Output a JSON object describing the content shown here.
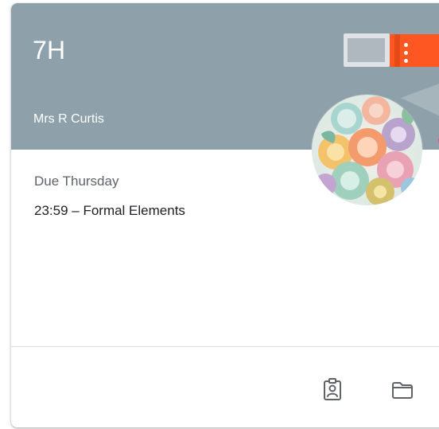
{
  "card": {
    "class_name": "7H",
    "teacher": "Mrs R Curtis",
    "menu_icon": "more-vert-icon"
  },
  "assignment": {
    "due_label": "Due Thursday",
    "title": "23:59 – Formal Elements"
  },
  "footer": {
    "actions": [
      {
        "name": "open-your-work",
        "icon": "assignment-ind-icon"
      },
      {
        "name": "open-class-folder",
        "icon": "folder-icon"
      }
    ]
  },
  "colors": {
    "header": "#8ea1aa",
    "accent_orange": "#f25a2b",
    "text_primary": "#202124",
    "text_secondary": "#5f6368",
    "divider": "#dadce0"
  }
}
